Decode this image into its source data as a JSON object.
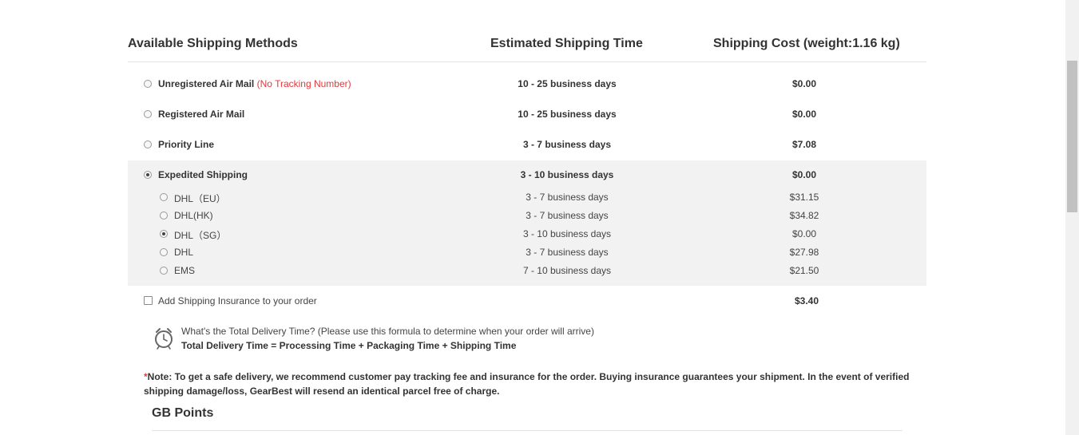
{
  "header": {
    "method": "Available Shipping Methods",
    "time": "Estimated Shipping Time",
    "cost": "Shipping Cost (weight:1.16 kg)"
  },
  "methods": [
    {
      "label": "Unregistered Air Mail",
      "note": "(No Tracking Number)",
      "time": "10 - 25 business days",
      "cost": "$0.00",
      "selected": false
    },
    {
      "label": "Registered Air Mail",
      "time": "10 - 25 business days",
      "cost": "$0.00",
      "selected": false
    },
    {
      "label": "Priority Line",
      "time": "3 - 7 business days",
      "cost": "$7.08",
      "selected": false
    },
    {
      "label": "Expedited Shipping",
      "time": "3 - 10 business days",
      "cost": "$0.00",
      "selected": true
    }
  ],
  "expedited_options": [
    {
      "label": "DHL（EU）",
      "time": "3 - 7 business days",
      "cost": "$31.15",
      "selected": false
    },
    {
      "label": "DHL(HK)",
      "time": "3 - 7 business days",
      "cost": "$34.82",
      "selected": false
    },
    {
      "label": "DHL（SG）",
      "time": "3 - 10 business days",
      "cost": "$0.00",
      "selected": true
    },
    {
      "label": "DHL",
      "time": "3 - 7 business days",
      "cost": "$27.98",
      "selected": false
    },
    {
      "label": "EMS",
      "time": "7 - 10 business days",
      "cost": "$21.50",
      "selected": false
    }
  ],
  "insurance": {
    "label": "Add Shipping Insurance to your order",
    "cost": "$3.40",
    "checked": false
  },
  "delivery_info": {
    "icon": "alarm-clock-icon",
    "question": "What's the Total Delivery Time? (Please use this formula to determine when your order will arrive)",
    "formula": "Total Delivery Time = Processing Time + Packaging Time + Shipping Time"
  },
  "note": {
    "star": "*",
    "text": "Note: To get a safe delivery, we recommend customer pay tracking fee and insurance for the order. Buying insurance guarantees your shipment. In the event of verified shipping damage/loss, GearBest will resend an identical parcel free of charge."
  },
  "gb_points": {
    "title": "GB Points"
  }
}
